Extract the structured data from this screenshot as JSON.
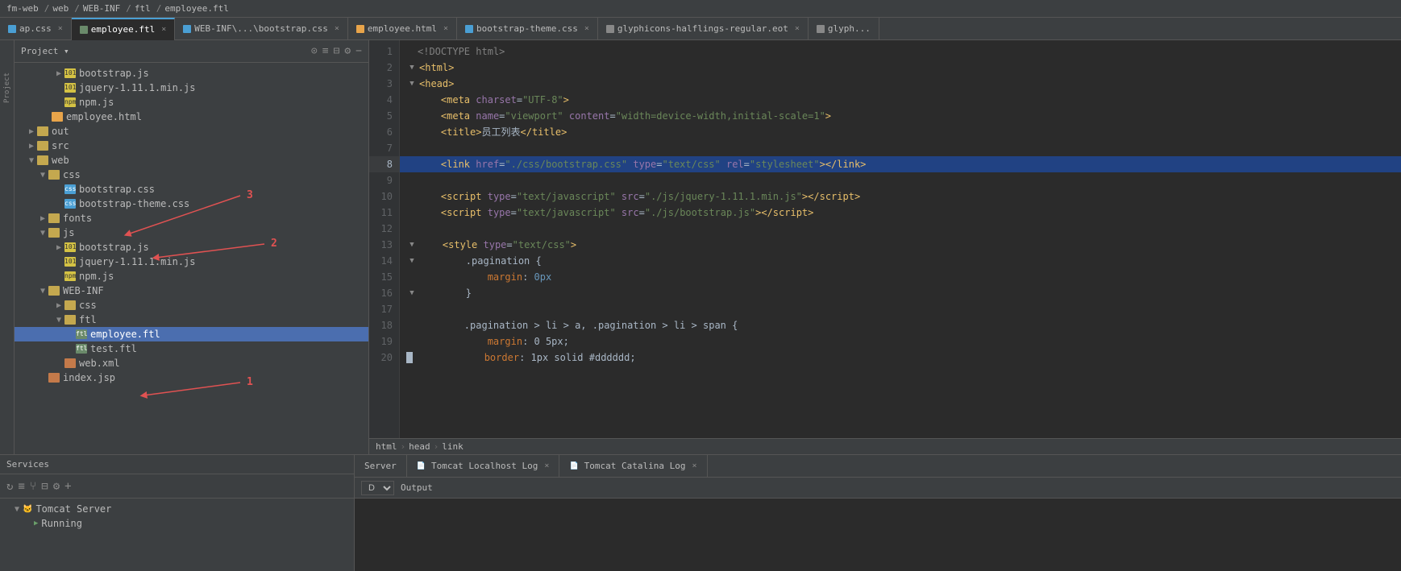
{
  "topbar": {
    "path": [
      "fm-web",
      "web",
      "WEB-INF",
      "ftl",
      "employee.ftl"
    ]
  },
  "tabs": [
    {
      "id": "ap.css",
      "label": "ap.css",
      "type": "css",
      "active": false,
      "closable": true
    },
    {
      "id": "employee.ftl",
      "label": "employee.ftl",
      "type": "ftl",
      "active": true,
      "closable": true
    },
    {
      "id": "bootstrap.css",
      "label": "WEB-INF\\...\\bootstrap.css",
      "type": "css",
      "active": false,
      "closable": true
    },
    {
      "id": "employee.html",
      "label": "employee.html",
      "type": "html",
      "active": false,
      "closable": true
    },
    {
      "id": "bootstrap-theme.css",
      "label": "bootstrap-theme.css",
      "type": "css",
      "active": false,
      "closable": true
    },
    {
      "id": "glyphicons-halflings-regular.eot",
      "label": "glyphicons-halflings-regular.eot",
      "type": "eot",
      "active": false,
      "closable": true
    },
    {
      "id": "glyph2",
      "label": "glyph...",
      "type": "eot",
      "active": false,
      "closable": false
    }
  ],
  "sidebar": {
    "title": "Project",
    "tree": [
      {
        "id": "bootstrap.js-1",
        "label": "bootstrap.js",
        "type": "js",
        "indent": 3,
        "expanded": false
      },
      {
        "id": "jquery.min.js-1",
        "label": "jquery-1.11.1.min.js",
        "type": "js",
        "indent": 3,
        "expanded": false
      },
      {
        "id": "npm.js-1",
        "label": "npm.js",
        "type": "js",
        "indent": 3,
        "expanded": false
      },
      {
        "id": "employee.html",
        "label": "employee.html",
        "type": "html",
        "indent": 2,
        "expanded": false
      },
      {
        "id": "out",
        "label": "out",
        "type": "folder",
        "indent": 1,
        "expanded": false
      },
      {
        "id": "src",
        "label": "src",
        "type": "folder",
        "indent": 1,
        "expanded": false
      },
      {
        "id": "web",
        "label": "web",
        "type": "folder",
        "indent": 1,
        "expanded": true
      },
      {
        "id": "css",
        "label": "css",
        "type": "folder",
        "indent": 2,
        "expanded": true
      },
      {
        "id": "bootstrap.css",
        "label": "bootstrap.css",
        "type": "css",
        "indent": 3,
        "expanded": false
      },
      {
        "id": "bootstrap-theme.css",
        "label": "bootstrap-theme.css",
        "type": "css",
        "indent": 3,
        "expanded": false
      },
      {
        "id": "fonts",
        "label": "fonts",
        "type": "folder",
        "indent": 2,
        "expanded": false
      },
      {
        "id": "js",
        "label": "js",
        "type": "folder",
        "indent": 2,
        "expanded": true
      },
      {
        "id": "bootstrap.js-2",
        "label": "bootstrap.js",
        "type": "js",
        "indent": 3,
        "expanded": false
      },
      {
        "id": "jquery.min.js-2",
        "label": "jquery-1.11.1.min.js",
        "type": "js",
        "indent": 3,
        "expanded": false
      },
      {
        "id": "npm.js-2",
        "label": "npm.js",
        "type": "js",
        "indent": 3,
        "expanded": false
      },
      {
        "id": "WEB-INF",
        "label": "WEB-INF",
        "type": "folder",
        "indent": 2,
        "expanded": true
      },
      {
        "id": "css-webinf",
        "label": "css",
        "type": "folder",
        "indent": 3,
        "expanded": false
      },
      {
        "id": "ftl",
        "label": "ftl",
        "type": "folder",
        "indent": 3,
        "expanded": true
      },
      {
        "id": "employee.ftl",
        "label": "employee.ftl",
        "type": "ftl",
        "indent": 4,
        "expanded": false,
        "selected": true
      },
      {
        "id": "test.ftl",
        "label": "test.ftl",
        "type": "ftl",
        "indent": 4,
        "expanded": false
      },
      {
        "id": "web.xml",
        "label": "web.xml",
        "type": "xml",
        "indent": 3,
        "expanded": false
      },
      {
        "id": "index.jsp",
        "label": "index.jsp",
        "type": "jsp",
        "indent": 2,
        "expanded": false
      }
    ]
  },
  "editor": {
    "lines": [
      {
        "num": 1,
        "tokens": [],
        "raw": ""
      },
      {
        "num": 2,
        "tokens": [],
        "raw": ""
      },
      {
        "num": 3,
        "tokens": [],
        "raw": ""
      },
      {
        "num": 4,
        "tokens": [],
        "raw": ""
      },
      {
        "num": 5,
        "tokens": [],
        "raw": ""
      },
      {
        "num": 6,
        "tokens": [],
        "raw": ""
      },
      {
        "num": 7,
        "tokens": [],
        "raw": ""
      },
      {
        "num": 8,
        "tokens": [],
        "raw": "",
        "highlighted": true
      },
      {
        "num": 9,
        "tokens": [],
        "raw": ""
      },
      {
        "num": 10,
        "tokens": [],
        "raw": ""
      },
      {
        "num": 11,
        "tokens": [],
        "raw": ""
      },
      {
        "num": 12,
        "tokens": [],
        "raw": ""
      },
      {
        "num": 13,
        "tokens": [],
        "raw": ""
      },
      {
        "num": 14,
        "tokens": [],
        "raw": ""
      },
      {
        "num": 15,
        "tokens": [],
        "raw": ""
      },
      {
        "num": 16,
        "tokens": [],
        "raw": ""
      },
      {
        "num": 17,
        "tokens": [],
        "raw": ""
      },
      {
        "num": 18,
        "tokens": [],
        "raw": ""
      },
      {
        "num": 19,
        "tokens": [],
        "raw": ""
      },
      {
        "num": 20,
        "tokens": [],
        "raw": ""
      }
    ],
    "breadcrumb": [
      "html",
      "head",
      "link"
    ],
    "annotations": [
      {
        "label": "1",
        "color": "red"
      },
      {
        "label": "2",
        "color": "red"
      },
      {
        "label": "3",
        "color": "red"
      }
    ]
  },
  "bottom": {
    "services_label": "Services",
    "tabs": [
      {
        "label": "Server",
        "active": false
      },
      {
        "label": "Tomcat Localhost Log",
        "active": false,
        "closable": true
      },
      {
        "label": "Tomcat Catalina Log",
        "active": false,
        "closable": true
      }
    ],
    "output_label": "Output",
    "server_label": "Tomcat Server",
    "running_label": "Running",
    "output_select": "D"
  }
}
